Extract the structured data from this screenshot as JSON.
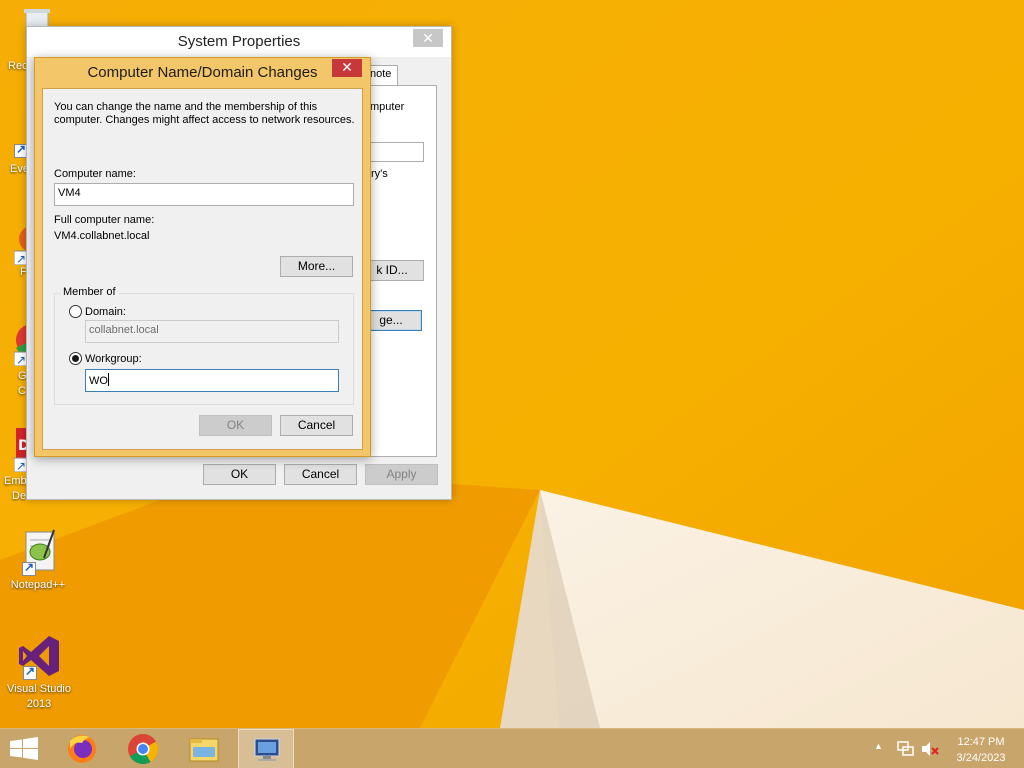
{
  "desktop": {
    "icons": [
      {
        "name": "recycle-bin",
        "label_partial": "Rec"
      },
      {
        "name": "everything",
        "label_partial": "Eve"
      },
      {
        "name": "firefox",
        "label_partial": "F"
      },
      {
        "name": "chrome",
        "label_partial_1": "G",
        "label_partial_2": "C"
      },
      {
        "name": "embarcadero",
        "label_partial_1": "Emb",
        "label_partial_2": "De"
      },
      {
        "name": "notepadpp",
        "label": "Notepad++"
      },
      {
        "name": "visual-studio",
        "label_line1": "Visual Studio",
        "label_line2": "2013"
      }
    ]
  },
  "system_properties": {
    "title": "System Properties",
    "close_glyph": "✕",
    "tab_partial": "note",
    "text_computer_partial": "mputer",
    "text_rys_partial": "ry's",
    "network_id_partial": "k ID...",
    "change_partial": "ge...",
    "ok_label": "OK",
    "cancel_label": "Cancel",
    "apply_label": "Apply"
  },
  "computer_name_dialog": {
    "title": "Computer Name/Domain Changes",
    "close_glyph": "✕",
    "description_line1": "You can change the name and the membership of this",
    "description_line2": "computer. Changes might affect access to network resources.",
    "computer_name_label": "Computer name:",
    "computer_name_value": "VM4",
    "full_name_label": "Full computer name:",
    "full_name_value": "VM4.collabnet.local",
    "more_button": "More...",
    "member_of_label": "Member of",
    "domain_label": "Domain:",
    "domain_value": "collabnet.local",
    "workgroup_label": "Workgroup:",
    "workgroup_value": "WO",
    "selected_option": "workgroup",
    "ok_label": "OK",
    "cancel_label": "Cancel"
  },
  "taskbar": {
    "items": [
      "start-button",
      "firefox",
      "chrome",
      "file-explorer",
      "system-properties"
    ],
    "time": "12:47 PM",
    "date": "3/24/2023"
  }
}
